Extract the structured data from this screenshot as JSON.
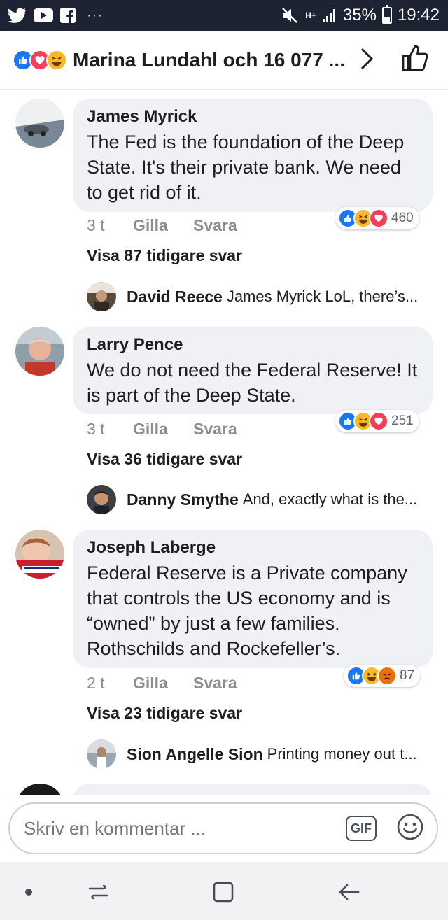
{
  "status_bar": {
    "battery_percent": "35%",
    "time": "19:42",
    "network": "H+",
    "dots": "···"
  },
  "header": {
    "title": "Marina Lundahl och 16 077 ..."
  },
  "comments": [
    {
      "author": "James Myrick",
      "text": "The Fed is the foundation of the Deep State. It's their private bank. We need to get rid of it.",
      "time": "3 t",
      "like_label": "Gilla",
      "reply_label": "Svara",
      "reaction_count": "460",
      "more_replies": "Visa 87 tidigare svar",
      "reply_preview": {
        "author": "David Reece",
        "text": "James Myrick LoL, there’s..."
      }
    },
    {
      "author": "Larry Pence",
      "text": "We do not need the Federal Reserve! It is  part of the Deep State.",
      "time": "3 t",
      "like_label": "Gilla",
      "reply_label": "Svara",
      "reaction_count": "251",
      "more_replies": "Visa 36 tidigare svar",
      "reply_preview": {
        "author": "Danny Smythe",
        "text": "And, exactly what is the..."
      }
    },
    {
      "author": "Joseph Laberge",
      "text": "Federal Reserve is a Private company that controls the US economy and is “owned” by just a few families. Rothschilds and Rockefeller’s.",
      "time": "2 t",
      "like_label": "Gilla",
      "reply_label": "Svara",
      "reaction_count": "87",
      "more_replies": "Visa 23 tidigare svar",
      "reply_preview": {
        "author": "Sion Angelle Sion",
        "text": "Printing money out t..."
      }
    }
  ],
  "compose": {
    "placeholder": "Skriv en kommentar ...",
    "gif_label": "GIF"
  },
  "colors": {
    "like": "#1877f2",
    "love": "#f33e58",
    "haha": "#f7b928",
    "angry": "#e9710f",
    "status_bar": "#1d2333",
    "bubble": "#eff1f4"
  }
}
